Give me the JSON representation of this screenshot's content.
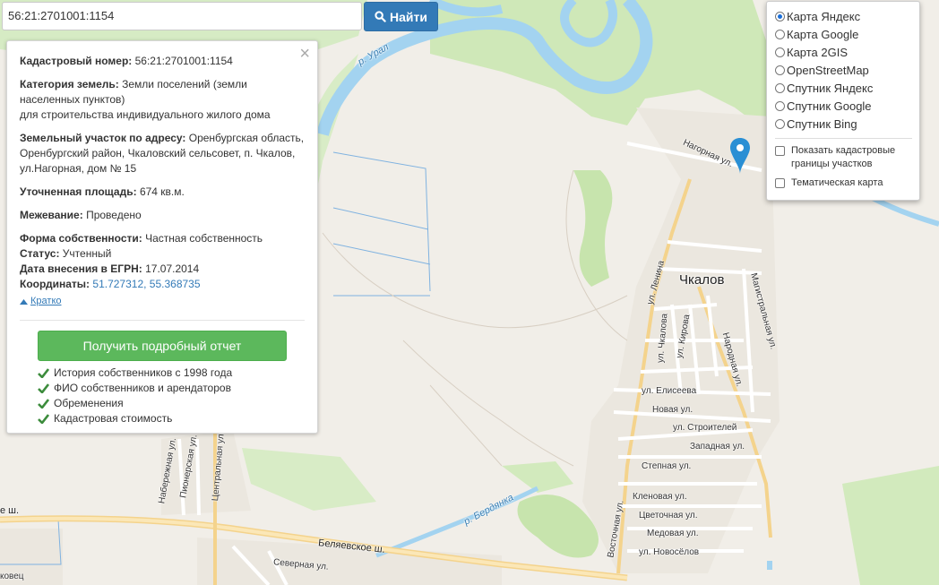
{
  "search": {
    "value": "56:21:2701001:1154",
    "button_label": "Найти",
    "button_icon": "search-icon"
  },
  "info": {
    "cadastral_label": "Кадастровый номер:",
    "cadastral_value": "56:21:2701001:1154",
    "category_label": "Категория земель:",
    "category_value": "Земли поселений (земли населенных пунктов)",
    "category_use": "для строительства индивидуального жилого дома",
    "address_label": "Земельный участок по адресу:",
    "address_value": "Оренбургская область, Оренбургский район, Чкаловский сельсовет, п. Чкалов, ул.Нагорная, дом № 15",
    "area_label": "Уточненная площадь:",
    "area_value": "674 кв.м.",
    "survey_label": "Межевание:",
    "survey_value": "Проведено",
    "ownership_label": "Форма собственности:",
    "ownership_value": "Частная собственность",
    "status_label": "Статус:",
    "status_value": "Учтенный",
    "egrn_label": "Дата внесения в ЕГРН:",
    "egrn_value": "17.07.2014",
    "coords_label": "Координаты:",
    "coords_value": "51.727312, 55.368735",
    "collapse_label": "Кратко",
    "report_button": "Получить подробный отчет",
    "features": [
      "История собственников с 1998 года",
      "ФИО собственников и арендаторов",
      "Обременения",
      "Кадастровая стоимость"
    ]
  },
  "layers": {
    "options": [
      "Карта Яндекс",
      "Карта Google",
      "Карта 2GIS",
      "OpenStreetMap",
      "Спутник Яндекс",
      "Спутник Google",
      "Спутник Bing"
    ],
    "selected": "Карта Яндекс",
    "checkbox_borders": "Показать кадастровые границы участков",
    "checkbox_thematic": "Тематическая карта"
  },
  "map_labels": {
    "river_ural": "р. Урал",
    "river_berdyanka": "р. Бердянка",
    "town": "Чкалов",
    "highway": "Беляевское ш.",
    "highway_left": "е ш.",
    "bottom_left": "ковец",
    "streets": [
      "Нагорная ул.",
      "ул. Ленина",
      "Магистральная ул.",
      "ул. Чкалова",
      "ул. Кирова",
      "Народная ул.",
      "ул. Елисеева",
      "Новая ул.",
      "ул. Строителей",
      "Западная ул.",
      "Степная ул.",
      "Кленовая ул.",
      "Цветочная ул.",
      "Медовая ул.",
      "ул. Новосёлов",
      "Восточная ул.",
      "Северная ул.",
      "Набережная ул.",
      "Пионерская ул.",
      "Центральная ул."
    ]
  },
  "colors": {
    "accent": "#337ab7",
    "report": "#5cb85c",
    "water": "#a3d3f0",
    "forest": "#cde8b5",
    "marker": "#2a8fd4"
  }
}
